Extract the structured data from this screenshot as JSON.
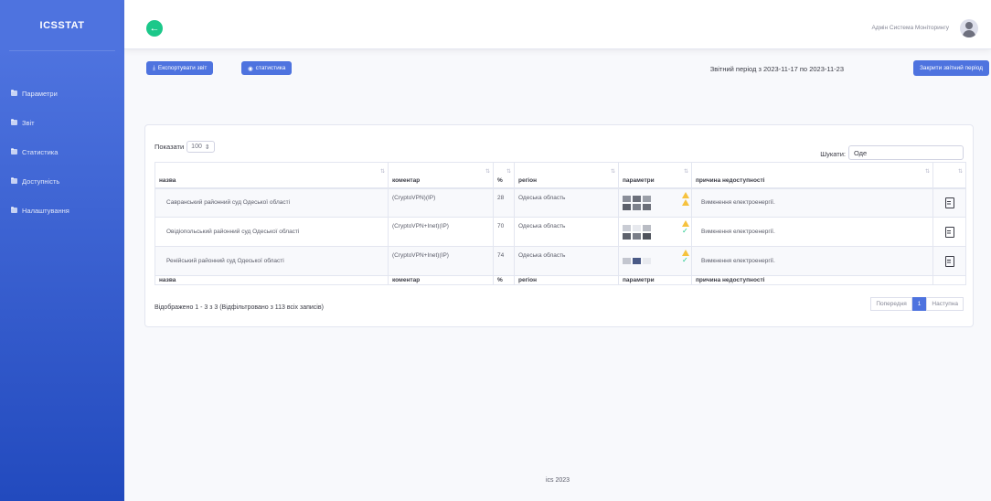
{
  "sidebar": {
    "brand": "ICSSTAT",
    "items": [
      {
        "label": "Параметри",
        "icon": "folder-icon"
      },
      {
        "label": "Звіт",
        "icon": "folder-icon"
      },
      {
        "label": "Статистика",
        "icon": "folder-icon"
      },
      {
        "label": "Доступність",
        "icon": "folder-icon"
      },
      {
        "label": "Налаштування",
        "icon": "folder-icon"
      }
    ]
  },
  "topbar": {
    "back_icon": "arrow-left-icon",
    "user_name": "Адмін Система Моніторингу",
    "avatar_icon": "user-avatar-icon"
  },
  "actions": {
    "export_label": "Експортувати звіт",
    "stats_label": "статистика",
    "period_text": "Звітний період з 2023-11-17 по 2023-11-23",
    "close_period_label": "Закрити звітний період"
  },
  "table": {
    "show_label": "Показати",
    "page_size": "100",
    "search_label": "Шукати:",
    "search_value": "Оде",
    "columns": [
      "назва",
      "коментар",
      "%",
      "регіон",
      "параметри",
      "причина недоступності",
      ""
    ],
    "rows": [
      {
        "name": "Савранський районний суд Одеської області",
        "comment": "(CryptoVPN)(IP)",
        "pct": "28",
        "region": "Одеська область",
        "status": [
          "warning",
          "warning"
        ],
        "reason": "Вимкнення електроенергії."
      },
      {
        "name": "Овідіопольський районний суд Одеської області",
        "comment": "(CryptoVPN+Inet)(IP)",
        "pct": "70",
        "region": "Одеська область",
        "status": [
          "warning",
          "ok"
        ],
        "reason": "Вимкнення електроенергії."
      },
      {
        "name": "Ренійський районний суд Одеської області",
        "comment": "(CryptoVPN+Inet)(IP)",
        "pct": "74",
        "region": "Одеська область",
        "status": [
          "warning",
          "ok"
        ],
        "reason": "Вимкнення електроенергії."
      }
    ],
    "info_text": "Відображено 1 - 3 з 3 (Відфільтровано з 113 всіх записів)",
    "pager": {
      "prev": "Попередня",
      "current": "1",
      "next": "Наступна"
    }
  },
  "footer": {
    "text": "ics 2023"
  },
  "colors": {
    "primary": "#4e73df",
    "success": "#1cc88a",
    "warning": "#f6c23e"
  }
}
